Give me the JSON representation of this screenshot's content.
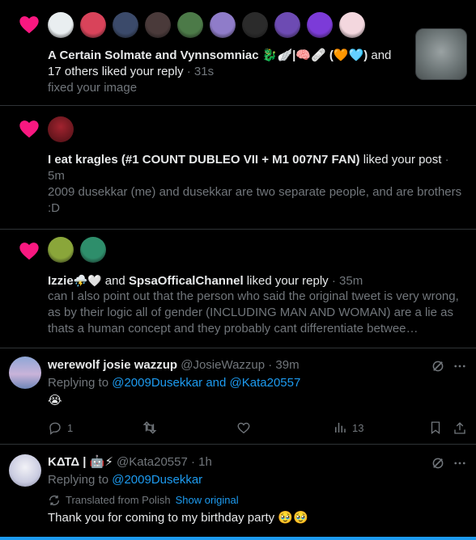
{
  "notif1": {
    "actors": "A Certain Solmate and Vynnsomniac 🐉🪽|🧠🩹 (🧡🩵)",
    "and": " and",
    "rest": "17 others liked your reply",
    "time": " · 31s",
    "text": "fixed your image",
    "avatar_colors": [
      "#e9eef0",
      "#d9435a",
      "#3b4a6a",
      "#4a3a3a",
      "#4c7a48",
      "#8f7cc9",
      "#2b2b2b",
      "#6d4bb3",
      "#7c3bd8",
      "#f3d7de"
    ]
  },
  "notif2": {
    "actor": "I eat kragles (#1 COUNT DUBLEO VII + M1 007N7 FAN)",
    "action": " liked your post",
    "time": " · 5m",
    "text": "2009 dusekkar (me) and dusekkar are two separate people, and are brothers :D",
    "avatar_color": "#a2232f"
  },
  "notif3": {
    "actor1": "Izzie",
    "actor1_emoji": "⛈️🤍",
    "and": " and ",
    "actor2": "SpsaOfficalChannel",
    "action": " liked your reply",
    "time": " · 35m",
    "text": "can I also point out that the person who said the original tweet is very wrong, as by their logic all of gender (INCLUDING MAN AND WOMAN) are a lie as thats a human concept and they probably cant differentiate betwee…",
    "avatar_colors": [
      "#8aa63a",
      "#2e8e6b"
    ]
  },
  "tweet1": {
    "name": "werewolf josie wazzup",
    "handle": "@JosieWazzup",
    "time": " · 39m",
    "replying": "Replying to ",
    "reply_to": "@2009Dusekkar and @Kata20557",
    "body": "😭",
    "replies": "1",
    "retweets": "",
    "likes": "",
    "views": "13",
    "avatar_color": "#8ea6d6"
  },
  "tweet2": {
    "name": "ΚΔΤΔ | 🤖⚡",
    "handle": "@Kata20557",
    "time": " · 1h",
    "replying": "Replying to ",
    "reply_to": "@2009Dusekkar",
    "translated": "Translated from Polish",
    "show_original": "Show original",
    "body": "Thank you for coming to my birthday party 🥹🥹",
    "avatar_color": "#c9cbe0"
  },
  "colors": {
    "heart": "#f91880",
    "link": "#1d9bf0",
    "dim": "#71767b",
    "accent_bar": "#1d9bf0"
  }
}
